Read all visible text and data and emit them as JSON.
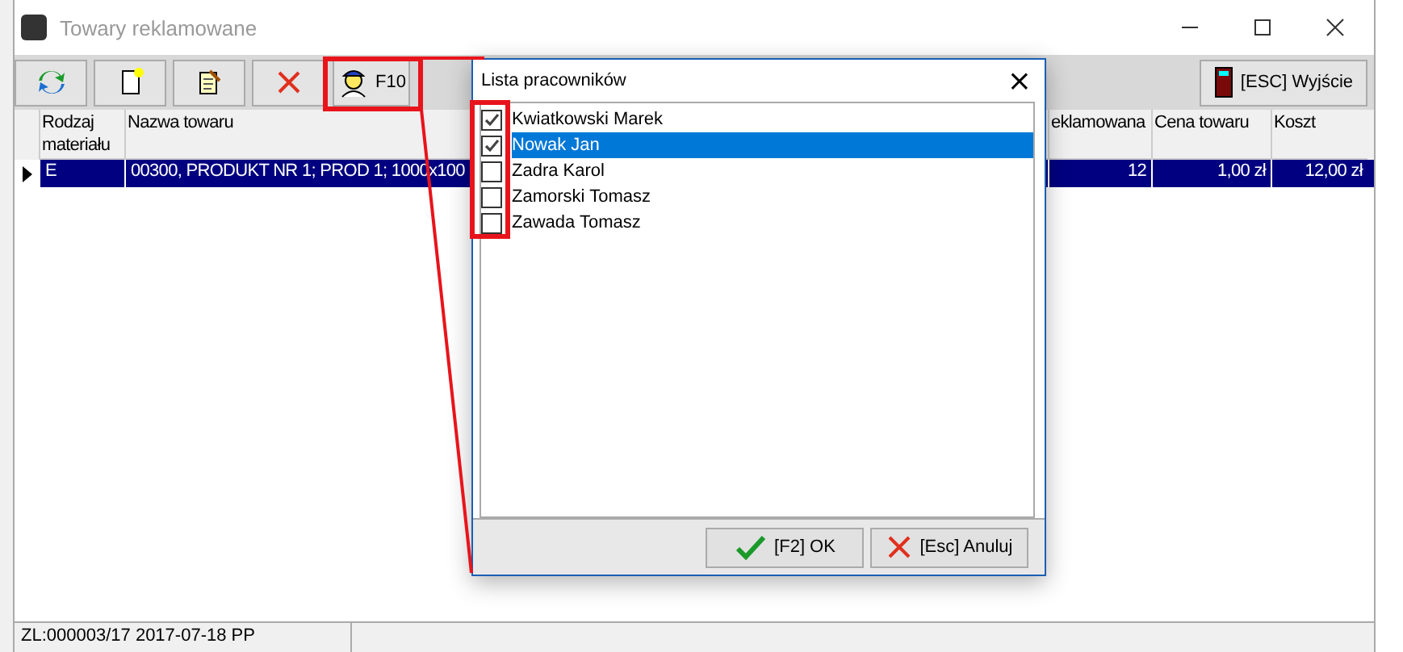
{
  "window": {
    "title": "Towary reklamowane"
  },
  "toolbar": {
    "buttons": [
      {
        "kind": "refresh"
      },
      {
        "kind": "new"
      },
      {
        "kind": "edit"
      },
      {
        "kind": "delete"
      },
      {
        "kind": "workers",
        "label": "F10"
      }
    ],
    "exit": "[ESC] Wyjście"
  },
  "table": {
    "columns": [
      "Rodzaj materiału",
      "Nazwa towaru",
      "eklamowana",
      "Cena towaru",
      "Koszt"
    ],
    "rows": [
      {
        "selected": true,
        "cells": [
          "E",
          "00300, PRODUKT NR 1; PROD 1; 1000x100",
          "12",
          "1,00 zł",
          "12,00 zł"
        ]
      }
    ]
  },
  "dialog": {
    "title": "Lista pracowników",
    "close": "×",
    "items": [
      {
        "name": "Kwiatkowski Marek",
        "checked": true,
        "selected": false
      },
      {
        "name": "Nowak Jan",
        "checked": true,
        "selected": true
      },
      {
        "name": "Zadra Karol",
        "checked": false,
        "selected": false
      },
      {
        "name": "Zamorski Tomasz",
        "checked": false,
        "selected": false
      },
      {
        "name": "Zawada Tomasz",
        "checked": false,
        "selected": false
      }
    ],
    "ok": "[F2] OK",
    "cancel": "[Esc] Anuluj"
  },
  "status_bar": "ZL:000003/17 2017-07-18 PP"
}
